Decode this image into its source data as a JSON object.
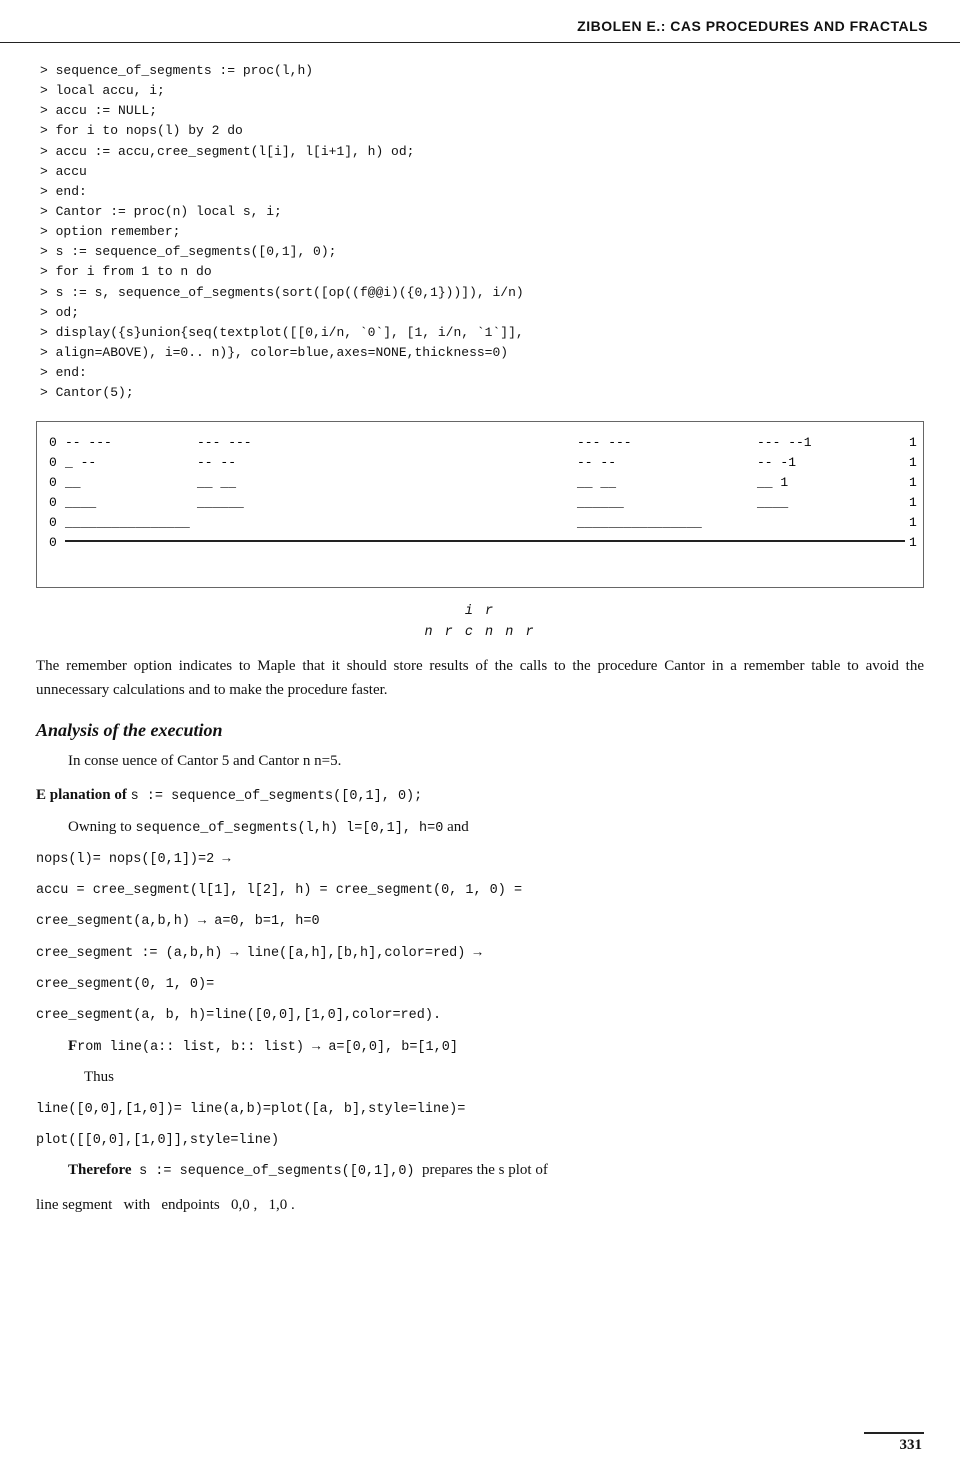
{
  "header": {
    "title": "ZIBOLEN E.: CAS PROCEDURES AND FRACTALS"
  },
  "code": {
    "lines": [
      "> sequence_of_segments := proc(l,h)",
      "> local accu, i;",
      "> accu := NULL;",
      "> for i to nops(l) by 2 do",
      "> accu := accu,cree_segment(l[i], l[i+1], h) od;",
      "> accu",
      "> end:",
      "> Cantor := proc(n) local s, i;",
      "> option remember;",
      "> s := sequence_of_segments([0,1], 0);",
      "> for i from 1 to n do",
      "> s := s, sequence_of_segments(sort([op((f@@i)({0,1}))]), i/n)",
      "> od;",
      "> display({s}union{seq(textplot([[0,i/n, `0`], [1, i/n, `1`]],",
      "> align=ABOVE), i=0.. n)}, color=blue,axes=NONE,thickness=0)",
      "> end:",
      "> Cantor(5);"
    ]
  },
  "figure_label": {
    "top": "i   r",
    "bottom": "n  r         c       n    n  r"
  },
  "body1": "The remember option indicates to Maple that it should store results of the calls to the procedure Cantor in a remember table to avoid the unnecessary calculations and to make the procedure faster.",
  "section_heading": "Analysis of the execution",
  "para1": "In conse uence of Cantor 5 and Cantor n  n=5.",
  "explanation_heading_prefix": "E planation of",
  "explanation_code": "s := sequence_of_segments([0,1], 0);",
  "owning_text": "Owning to",
  "owning_code": "sequence_of_segments(l,h) l=[0,1], h=0",
  "owning_and": "and",
  "nops_line": "nops(l)= nops([0,1])=2 →",
  "accu_line": "accu = cree_segment(l[1], l[2], h) = cree_segment(0, 1, 0) =",
  "cree1": "cree_segment(a,b,h) → a=0, b=1, h=0",
  "cree2": "cree_segment := (a,b,h) → line([a,h],[b,h],color=red) →",
  "cree3": "cree_segment(0, 1, 0)=",
  "cree4": "cree_segment(a, b, h)=line([0,0],[1,0],color=red).",
  "rom_line": "rom line(a:: list, b:: list) → a=[0,0], b=[1,0]",
  "thus_label": "Thus",
  "line1": "line([0,0],[1,0])= line(a,b)=plot([a, b],style=line)=",
  "line2": "plot([[0,0],[1,0]],style=line)",
  "therefore_line": "Therefore s := sequence_of_segments([0,1],0) prepares the s plot of",
  "last_line": "line segment  with  endpoints  0,0 ,  1,0 .",
  "footer": {
    "page_number": "331"
  }
}
